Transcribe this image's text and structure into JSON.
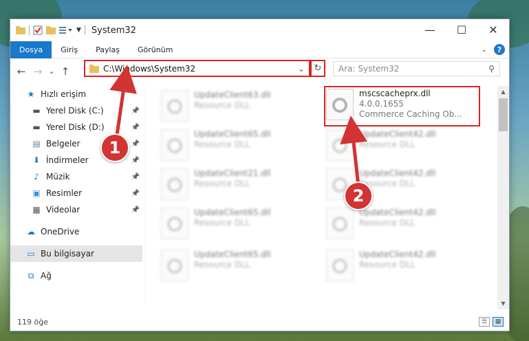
{
  "window": {
    "title": "System32",
    "controls": {
      "minimize": "—",
      "maximize": "☐",
      "close": "✕"
    }
  },
  "ribbon": {
    "tabs": [
      {
        "label": "Dosya",
        "active": true
      },
      {
        "label": "Giriş"
      },
      {
        "label": "Paylaş"
      },
      {
        "label": "Görünüm"
      }
    ],
    "help": "?"
  },
  "nav": {
    "back": "←",
    "forward": "→",
    "recent": "⌄",
    "up": "↑",
    "address": "C:\\Windows\\System32",
    "address_dropdown": "⌄",
    "refresh": "↻",
    "search_placeholder": "Ara: System32"
  },
  "sidebar": {
    "items": [
      {
        "label": "Hızlı erişim",
        "icon": "star-icon",
        "glyph": "★",
        "color": "#1979ca",
        "pinned": false,
        "indent": 0
      },
      {
        "label": "Yerel Disk (C:)",
        "icon": "drive-icon",
        "glyph": "▬",
        "color": "#555",
        "pinned": true,
        "indent": 1
      },
      {
        "label": "Yerel Disk (D:)",
        "icon": "drive-icon",
        "glyph": "▬",
        "color": "#555",
        "pinned": true,
        "indent": 1
      },
      {
        "label": "Belgeler",
        "icon": "documents-icon",
        "glyph": "▤",
        "color": "#6b7f96",
        "pinned": true,
        "indent": 1
      },
      {
        "label": "İndirmeler",
        "icon": "download-icon",
        "glyph": "⬇",
        "color": "#1979ca",
        "pinned": true,
        "indent": 1
      },
      {
        "label": "Müzik",
        "icon": "music-icon",
        "glyph": "♪",
        "color": "#1979ca",
        "pinned": true,
        "indent": 1
      },
      {
        "label": "Resimler",
        "icon": "pictures-icon",
        "glyph": "▣",
        "color": "#3a8fd6",
        "pinned": true,
        "indent": 1
      },
      {
        "label": "Videolar",
        "icon": "video-icon",
        "glyph": "▦",
        "color": "#555",
        "pinned": true,
        "indent": 1
      },
      {
        "label": "OneDrive",
        "icon": "cloud-icon",
        "glyph": "☁",
        "color": "#1979ca",
        "pinned": false,
        "indent": 0
      },
      {
        "label": "Bu bilgisayar",
        "icon": "computer-icon",
        "glyph": "▭",
        "color": "#1979ca",
        "pinned": false,
        "indent": 0,
        "selected": true
      },
      {
        "label": "Ağ",
        "icon": "network-icon",
        "glyph": "⧉",
        "color": "#1979ca",
        "pinned": false,
        "indent": 0
      }
    ]
  },
  "files": {
    "highlighted": {
      "name": "mscscacheprx.dll",
      "version": "4.0.0.1655",
      "description": "Commerce Caching Ob..."
    },
    "left_column": [
      {
        "name": "UpdateClient63.dll",
        "type": "Resource DLL"
      },
      {
        "name": "UpdateClient65.dll",
        "type": "Resource DLL"
      },
      {
        "name": "UpdateClient21.dll",
        "type": "Resource DLL"
      },
      {
        "name": "UpdateClient65.dll",
        "type": "Resource DLL"
      },
      {
        "name": "UpdateClient65.dll",
        "type": "Resource DLL"
      }
    ],
    "right_column": [
      {
        "name": "UpdateClient42.dll",
        "type": "Resource DLL"
      },
      {
        "name": "UpdateClient42.dll",
        "type": "Resource DLL"
      },
      {
        "name": "UpdateClient42.dll",
        "type": "Resource DLL"
      },
      {
        "name": "UpdateClient42.dll",
        "type": "Resource DLL"
      }
    ]
  },
  "status": {
    "count": "119 öğe"
  },
  "annotations": {
    "step1": "1",
    "step2": "2",
    "color": "#d23333"
  }
}
